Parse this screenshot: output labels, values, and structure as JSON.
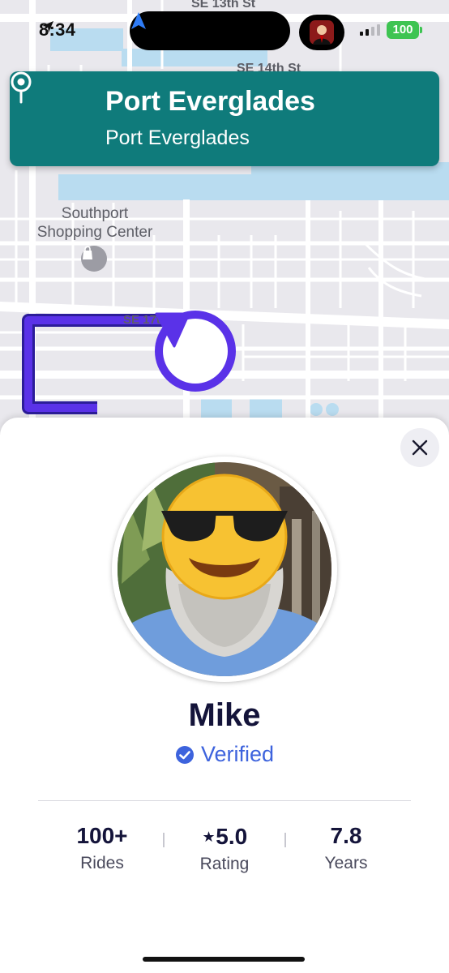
{
  "status_bar": {
    "time": "8:34",
    "battery": "100",
    "location_icon": "location-arrow-icon",
    "nav_icon": "navigation-arrow-icon"
  },
  "map": {
    "streets": [
      "SE 13th St",
      "SE 14th St",
      "SE 17th"
    ],
    "poi_label": "Southport\nShopping Center",
    "poi_icon": "shopping-bag-icon",
    "route_color": "#5a32e8"
  },
  "destination": {
    "title": "Port Everglades",
    "subtitle": "Port Everglades",
    "icon": "map-pin-icon",
    "color": "#0f7b7b"
  },
  "driver": {
    "name": "Mike",
    "verified_label": "Verified",
    "verified_color": "#3d63dd",
    "stats": [
      {
        "value": "100+",
        "label": "Rides"
      },
      {
        "value": "⋆5.0",
        "label": "Rating"
      },
      {
        "value": "7.8",
        "label": "Years"
      }
    ]
  },
  "controls": {
    "close_icon": "close-icon"
  }
}
